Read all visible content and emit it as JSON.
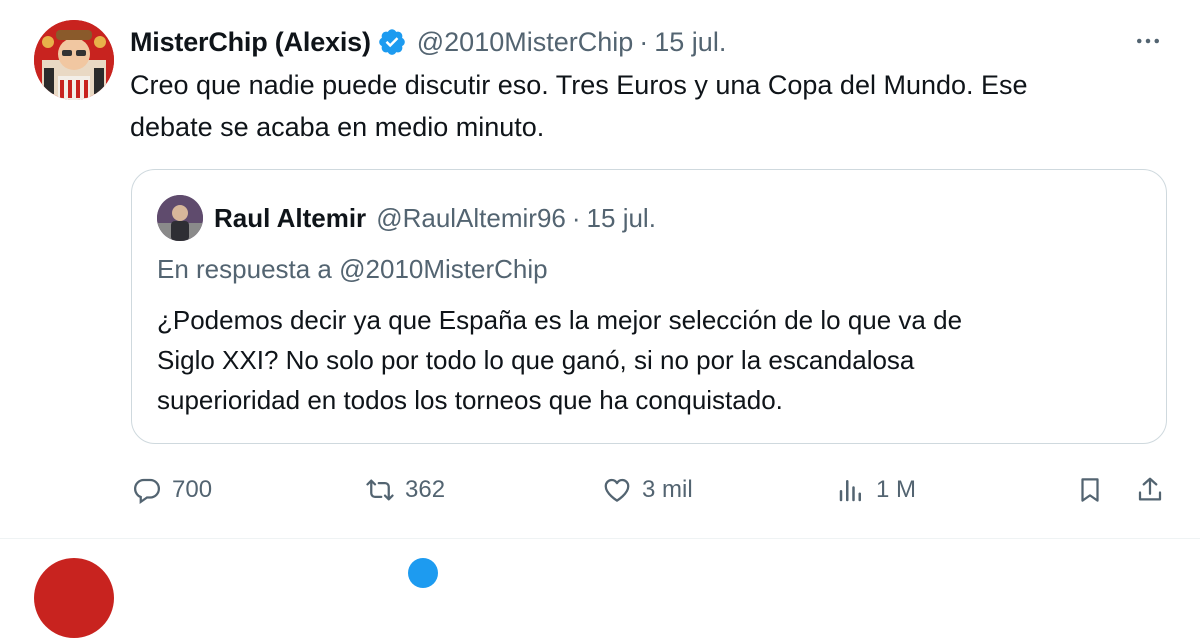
{
  "tweet": {
    "display_name": "MisterChip (Alexis)",
    "handle": "@2010MisterChip",
    "separator": "·",
    "time": "15 jul.",
    "text_line1": "Creo que nadie puede discutir eso. Tres Euros y una Copa del Mundo. Ese",
    "text_line2": "debate se acaba en medio minuto.",
    "avatar_icon": "profile-avatar",
    "verified_icon": "verified-badge-icon",
    "more_icon": "more-dots-icon"
  },
  "quoted": {
    "display_name": "Raul Altemir",
    "handle": "@RaulAltemir96",
    "separator": "·",
    "time": "15 jul.",
    "reply_prefix": "En respuesta a",
    "reply_to": "@2010MisterChip",
    "text_line1": "¿Podemos decir ya que España es la mejor selección de lo que va de",
    "text_line2": "Siglo XXI? No solo por todo lo que ganó, si no por la escandalosa",
    "text_line3": "superioridad en todos los torneos que ha conquistado."
  },
  "actions": {
    "replies": "700",
    "retweets": "362",
    "likes": "3 mil",
    "views": "1 M",
    "icons": [
      "reply-icon",
      "retweet-icon",
      "like-icon",
      "views-icon",
      "bookmark-icon",
      "share-icon"
    ]
  },
  "colors": {
    "text": "#0f1419",
    "secondary": "#536471",
    "border": "#cfd9de",
    "verified": "#1d9bf0"
  }
}
